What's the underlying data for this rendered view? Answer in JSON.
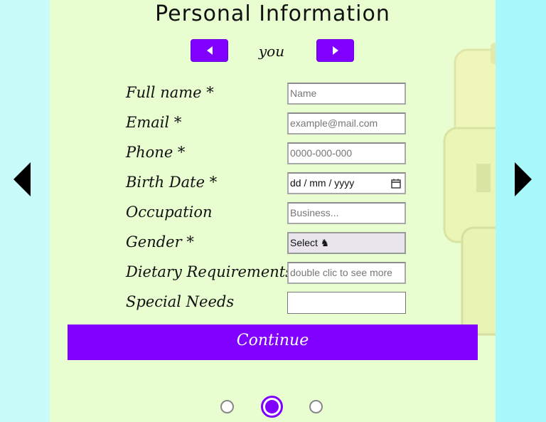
{
  "form": {
    "title": "Personal Information",
    "subject": "you",
    "fields": [
      {
        "label": "Full name *",
        "placeholder": "Name"
      },
      {
        "label": "Email *",
        "placeholder": "example@mail.com"
      },
      {
        "label": "Phone *",
        "placeholder": "0000-000-000"
      },
      {
        "label": "Birth Date *",
        "value": "dd / mm / yyyy"
      },
      {
        "label": "Occupation",
        "placeholder": "Business..."
      },
      {
        "label": "Gender *",
        "value": "Select ♞"
      },
      {
        "label": "Dietary Requirements *",
        "placeholder": "double clic to see more"
      },
      {
        "label": "Special Needs",
        "value": ""
      }
    ],
    "continue_label": "Continue"
  },
  "pager": {
    "count": 3,
    "active_index": 1
  },
  "colors": {
    "accent": "#8000ff",
    "panel": "#e8fdd0",
    "side": "#cdfcfc"
  },
  "icons": [
    "arrow-left-icon",
    "arrow-right-icon",
    "calendar-icon",
    "chevron-left-icon",
    "chevron-right-icon"
  ]
}
